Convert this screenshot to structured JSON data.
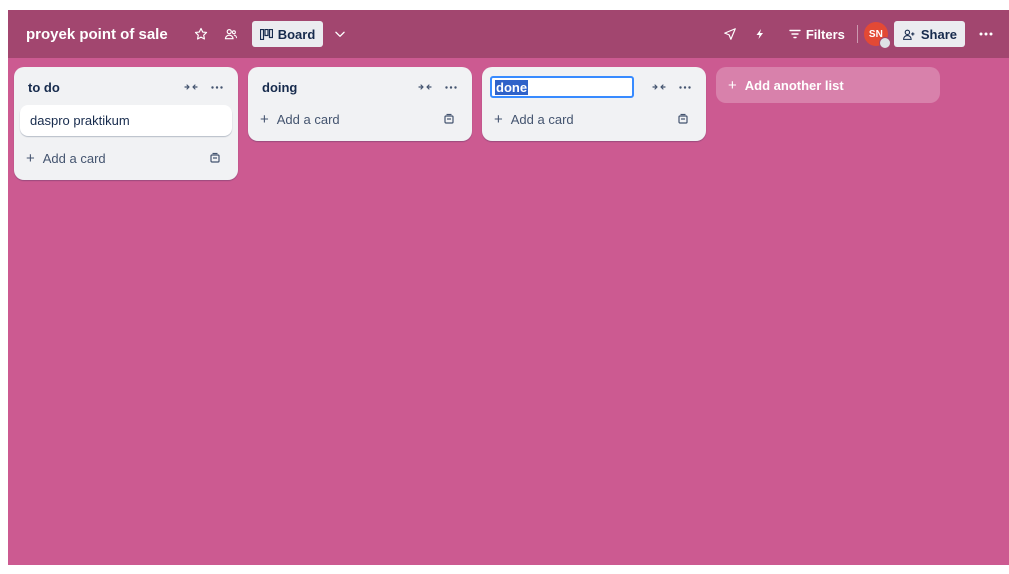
{
  "colors": {
    "board_bg": "#cc5a91",
    "header_bg": "#a2466f",
    "avatar_bg": "#e34935",
    "selection": "#2f62c9"
  },
  "header": {
    "title": "proyek point of sale",
    "star_icon": "star-icon",
    "visibility_icon": "team-visibility-icon",
    "view_label": "Board",
    "view_icon": "board-view-icon",
    "view_switcher_icon": "chevron-down-icon",
    "powerups_icon": "send-icon",
    "automation_icon": "lightning-icon",
    "filters_label": "Filters",
    "avatar_initials": "SN",
    "share_label": "Share",
    "more_icon": "more-icon"
  },
  "lists": [
    {
      "title": "to do",
      "cards": [
        "daspro praktikum"
      ],
      "add_card_label": "Add a card"
    },
    {
      "title": "doing",
      "cards": [],
      "add_card_label": "Add a card"
    },
    {
      "title": "done",
      "editing": true,
      "cards": [],
      "add_card_label": "Add a card"
    }
  ],
  "add_list_label": "Add another list"
}
